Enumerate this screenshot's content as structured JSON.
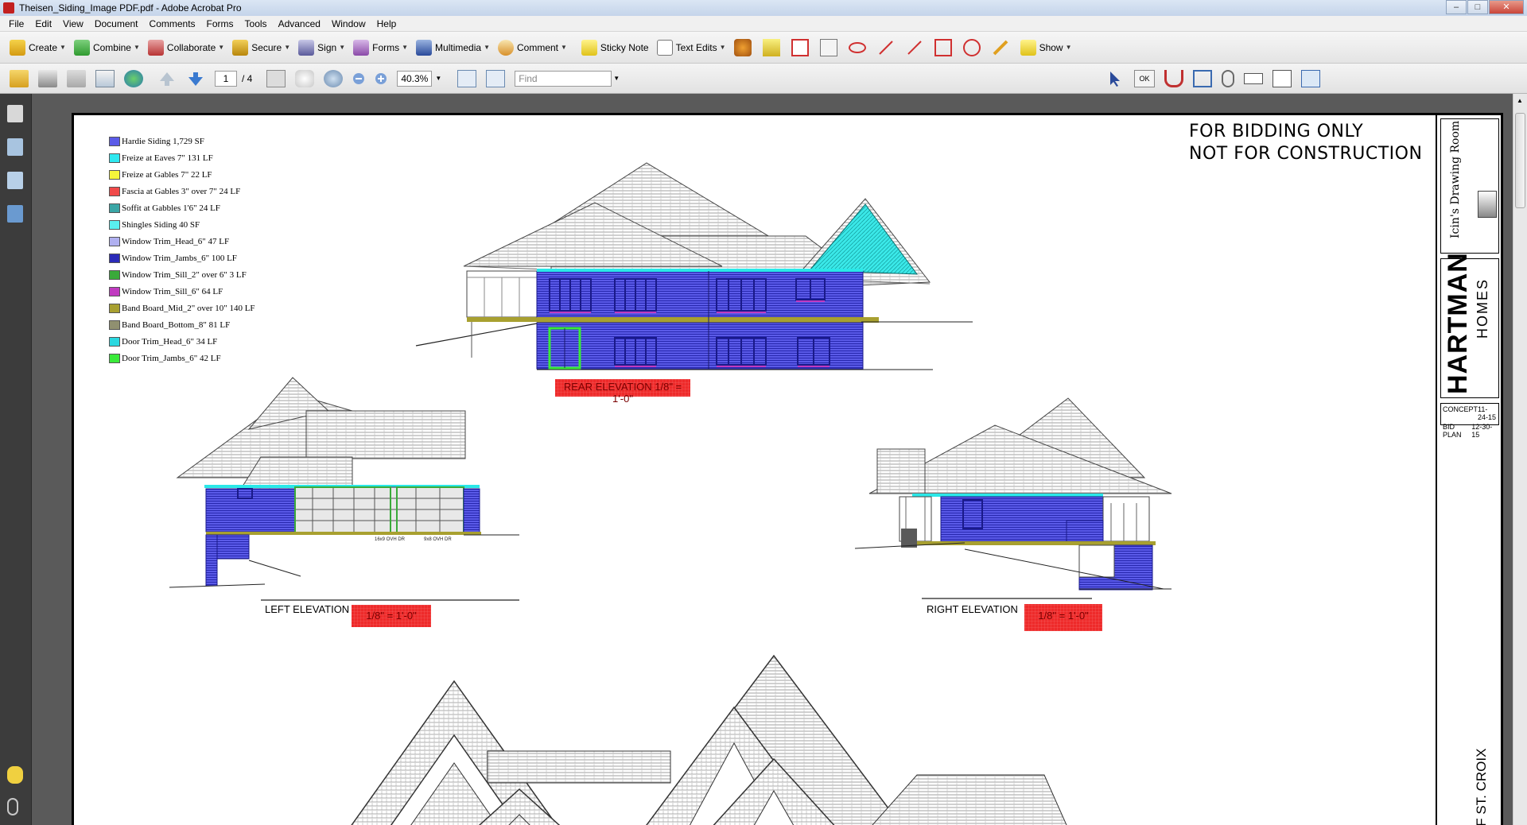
{
  "window": {
    "title": "Theisen_Siding_Image PDF.pdf - Adobe Acrobat Pro",
    "controls": [
      "–",
      "□",
      "✕"
    ]
  },
  "menu": [
    "File",
    "Edit",
    "View",
    "Document",
    "Comments",
    "Forms",
    "Tools",
    "Advanced",
    "Window",
    "Help"
  ],
  "toolbar": {
    "create": "Create",
    "combine": "Combine",
    "collaborate": "Collaborate",
    "secure": "Secure",
    "sign": "Sign",
    "forms": "Forms",
    "multimedia": "Multimedia",
    "comment": "Comment",
    "sticky_note": "Sticky Note",
    "text_edits": "Text Edits",
    "show": "Show"
  },
  "navigation": {
    "current_page": "1",
    "total_pages": "/ 4",
    "zoom": "40.3%",
    "find_placeholder": "Find",
    "ok_label": "OK"
  },
  "document": {
    "notice_line1": "FOR BIDDING ONLY",
    "notice_line2": "NOT FOR CONSTRUCTION",
    "legend": [
      {
        "label": "Hardie Siding  1,729 SF",
        "color": "#5b5be8"
      },
      {
        "label": "Freize at Eaves 7\"  131 LF",
        "color": "#2ee8f0"
      },
      {
        "label": "Freize at Gables 7\"  22 LF",
        "color": "#f5f53a"
      },
      {
        "label": "Fascia at Gables 3\" over 7\"  24 LF",
        "color": "#f04a4a"
      },
      {
        "label": "Soffit at Gabbles 1'6\"  24 LF",
        "color": "#3aa6a6"
      },
      {
        "label": "Shingles Siding  40 SF",
        "color": "#5af0f0"
      },
      {
        "label": "Window Trim_Head_6\"  47 LF",
        "color": "#b0b0f0"
      },
      {
        "label": "Window Trim_Jambs_6\"  100 LF",
        "color": "#2a2ab8"
      },
      {
        "label": "Window Trim_Sill_2\" over 6\"  3 LF",
        "color": "#3aaa3a"
      },
      {
        "label": "Window Trim_Sill_6\"  64 LF",
        "color": "#c03ac0"
      },
      {
        "label": "Band Board_Mid_2\" over 10\"  140 LF",
        "color": "#a8a030"
      },
      {
        "label": "Band Board_Bottom_8\"  81 LF",
        "color": "#909070"
      },
      {
        "label": "Door Trim_Head_6\"  34 LF",
        "color": "#2ad8e0"
      },
      {
        "label": "Door Trim_Jambs_6\"  42 LF",
        "color": "#3aea3a"
      }
    ],
    "rear_elevation": {
      "label": "REAR ELEVATION",
      "scale": "1/8\" = 1'-0\""
    },
    "left_elevation": {
      "label": "LEFT ELEVATION",
      "scale": "1/8\" = 1'-0\""
    },
    "right_elevation": {
      "label": "RIGHT ELEVATION",
      "scale": "1/8\" = 1'-0\""
    },
    "garage_labels": [
      "16x9 OVH DR",
      "9x8 OVH DR"
    ],
    "title_block": {
      "firm": "Icin's Drawing Room",
      "builder_line1": "HARTMAN",
      "builder_line2": "HOMES",
      "concept_label": "CONCEPT",
      "concept_date": "11-24-15",
      "bid_label": "BID PLAN",
      "bid_date": "12-30-15",
      "location": "OF ST. CROIX"
    }
  },
  "colors": {
    "siding": "#3a3ad8",
    "scale_tag": "#ee2a2a",
    "roof_line": "#7a7a7a"
  }
}
